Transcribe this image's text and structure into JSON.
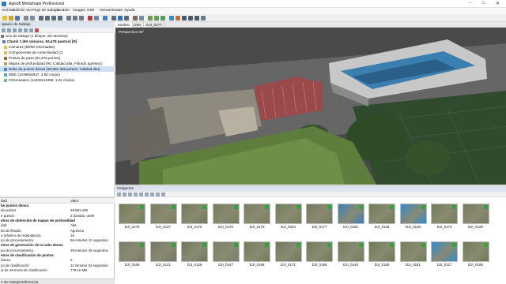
{
  "window": {
    "title": "Agisoft Metashape Professional",
    "minimize_glyph": "–",
    "maximize_glyph": "□",
    "close_glyph": "✕"
  },
  "menu": {
    "items": [
      "Archivo",
      "Edición",
      "Ver",
      "Flujo de trabajo",
      "Modelo",
      "Imagen",
      "Orto",
      "Herramientas",
      "Ayuda"
    ]
  },
  "workspace": {
    "title": "spacio de trabajo",
    "items": [
      {
        "label": "acio de trabajo (1 bloque, 90 cámaras)",
        "icon": "workspace-icon",
        "color": "#7a7a7a",
        "selected": false
      },
      {
        "label": "Chunk 1 (90 cámaras, 84,478 puntos) [R]",
        "icon": "chunk-icon",
        "color": "#5b7fb5",
        "selected": false
      },
      {
        "label": "Cámaras (90/90 Orientadas)",
        "icon": "folder-icon",
        "color": "#e7b84b",
        "selected": false
      },
      {
        "label": "Componentes de conectividad (1)",
        "icon": "folder-icon",
        "color": "#e7b84b",
        "selected": false
      },
      {
        "label": "Puntos de paso (84,478 puntos)",
        "icon": "tie-points-icon",
        "color": "#9a6a3a",
        "selected": false
      },
      {
        "label": "Mapas de profundidad (90, Calidad alta, Filtrado agresivo)",
        "icon": "depth-maps-icon",
        "color": "#c0a060",
        "selected": false
      },
      {
        "label": "Nube de puntos densa (39,581,405 puntos, Calidad alta)",
        "icon": "dense-cloud-icon",
        "color": "#3d88c6",
        "selected": true
      },
      {
        "label": "MDE (10398x8537, 3.84 cm/px)",
        "icon": "dem-icon",
        "color": "#4aa0c8",
        "selected": false
      },
      {
        "label": "Ortomosaico (14468x11358, 1.92 cm/px)",
        "icon": "orthomosaic-icon",
        "color": "#7cb87a",
        "selected": false
      }
    ]
  },
  "properties": {
    "col_key": "dad",
    "col_value": "Valor",
    "rows": [
      {
        "key": "be puntos densa",
        "value": "",
        "section": true
      },
      {
        "key": "de puntos",
        "value": "39,581,405",
        "section": false
      },
      {
        "key": "e puntos",
        "value": "2 bandas, uint8",
        "section": false
      },
      {
        "key": "etros de obtención de mapas de profundidad",
        "value": "",
        "section": true
      },
      {
        "key": "dad",
        "value": "Alta",
        "section": false
      },
      {
        "key": "do de filtrado",
        "value": "Agresivo",
        "section": false
      },
      {
        "key": "o máximo de redundancia",
        "value": "16",
        "section": false
      },
      {
        "key": "po de procesamiento",
        "value": "56 minutos 11 segundos",
        "section": false
      },
      {
        "key": "etros de generación de la nube densa",
        "value": "",
        "section": true
      },
      {
        "key": "po de procesamiento",
        "value": "39 minutos 45 segundos",
        "section": false
      },
      {
        "key": "etros de clasificación de puntos",
        "value": "",
        "section": true
      },
      {
        "key": "ñanza",
        "value": "0",
        "section": false
      },
      {
        "key": "po de clasificación",
        "value": "11 minutos 34 segundos",
        "section": false
      },
      {
        "key": "ia de memoria de clasificación",
        "value": "779.16 MB",
        "section": false
      }
    ],
    "tabs": [
      "o de trabajo",
      "Referencia"
    ]
  },
  "viewport": {
    "tabs": [
      "Modelo",
      "Orto",
      "DJI_0177"
    ],
    "active_tab": 0,
    "perspective_label": "Perspective 30°"
  },
  "images": {
    "title": "Imágenes",
    "rows": [
      [
        {
          "label": "DJI_0179",
          "tone": "#6e7f55"
        },
        {
          "label": "DJI_0137",
          "tone": "#7a8060"
        },
        {
          "label": "DJI_0176",
          "tone": "#6f7c58"
        },
        {
          "label": "DJI_0175",
          "tone": "#727f5a"
        },
        {
          "label": "DJI_0178",
          "tone": "#7b7f62"
        },
        {
          "label": "DJI_0184",
          "tone": "#6f8159"
        },
        {
          "label": "DJI_0177",
          "tone": "#74795e"
        },
        {
          "label": "DJI_0183",
          "tone": "#3c7fb8"
        },
        {
          "label": "DJI_0136",
          "tone": "#6d7c55"
        },
        {
          "label": "DJI_0138",
          "tone": "#2e8bd0"
        },
        {
          "label": "DJI_0174",
          "tone": "#6f8157"
        },
        {
          "label": "DJI_0129",
          "tone": "#737c5d"
        }
      ],
      [
        {
          "label": "DJI_0169",
          "tone": "#7b7a6a"
        },
        {
          "label": "DJI_0121",
          "tone": "#717766"
        },
        {
          "label": "DJI_0128",
          "tone": "#6c7a5b"
        },
        {
          "label": "DJI_0147",
          "tone": "#78806a"
        },
        {
          "label": "DJI_0168",
          "tone": "#707e59"
        },
        {
          "label": "DJI_0171",
          "tone": "#6f7a5e"
        },
        {
          "label": "DJI_0186",
          "tone": "#6e7d58"
        },
        {
          "label": "DJI_0146",
          "tone": "#737e60"
        },
        {
          "label": "DJI_0180",
          "tone": "#6b7a55"
        },
        {
          "label": "DJI_0181",
          "tone": "#717f5a"
        },
        {
          "label": "DJI_0117",
          "tone": "#2f8ccf"
        },
        {
          "label": "DJI_0185",
          "tone": "#6d7b56"
        }
      ]
    ]
  }
}
